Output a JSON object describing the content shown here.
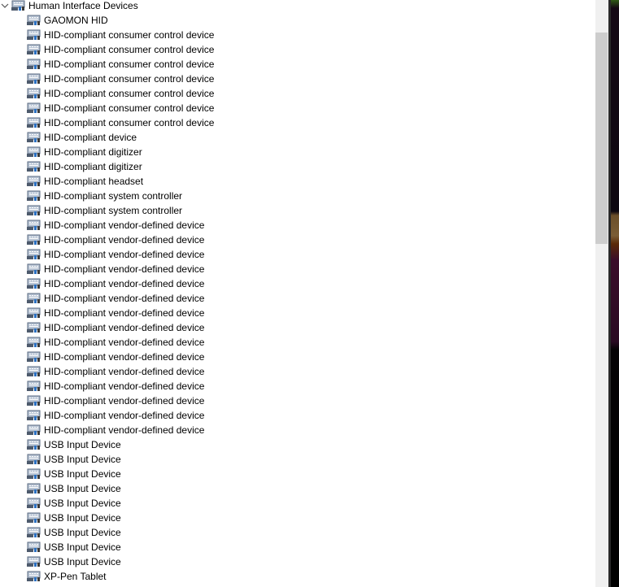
{
  "category": {
    "label": "Human Interface Devices",
    "expanded": true,
    "icon": "hid-device-icon"
  },
  "devices": [
    "GAOMON HID",
    "HID-compliant consumer control device",
    "HID-compliant consumer control device",
    "HID-compliant consumer control device",
    "HID-compliant consumer control device",
    "HID-compliant consumer control device",
    "HID-compliant consumer control device",
    "HID-compliant consumer control device",
    "HID-compliant device",
    "HID-compliant digitizer",
    "HID-compliant digitizer",
    "HID-compliant headset",
    "HID-compliant system controller",
    "HID-compliant system controller",
    "HID-compliant vendor-defined device",
    "HID-compliant vendor-defined device",
    "HID-compliant vendor-defined device",
    "HID-compliant vendor-defined device",
    "HID-compliant vendor-defined device",
    "HID-compliant vendor-defined device",
    "HID-compliant vendor-defined device",
    "HID-compliant vendor-defined device",
    "HID-compliant vendor-defined device",
    "HID-compliant vendor-defined device",
    "HID-compliant vendor-defined device",
    "HID-compliant vendor-defined device",
    "HID-compliant vendor-defined device",
    "HID-compliant vendor-defined device",
    "HID-compliant vendor-defined device",
    "USB Input Device",
    "USB Input Device",
    "USB Input Device",
    "USB Input Device",
    "USB Input Device",
    "USB Input Device",
    "USB Input Device",
    "USB Input Device",
    "USB Input Device",
    "XP-Pen Tablet"
  ]
}
